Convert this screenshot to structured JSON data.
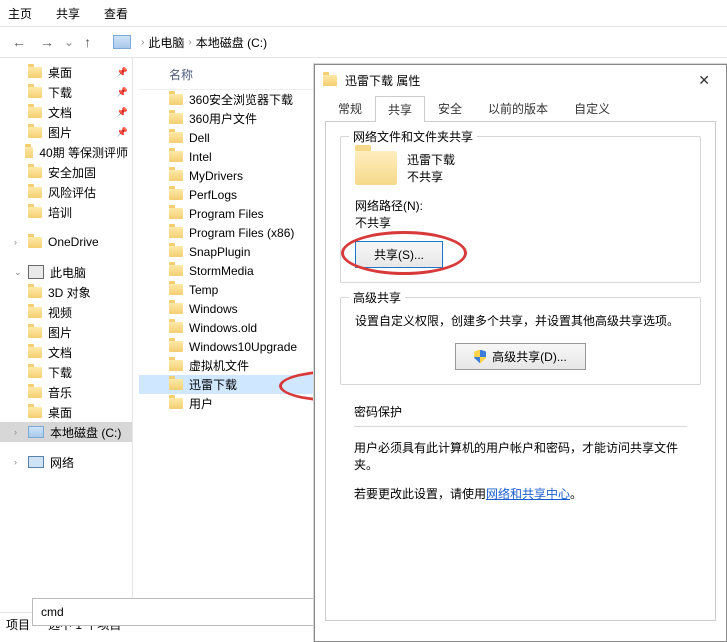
{
  "top_tabs": {
    "home": "主页",
    "share": "共享",
    "view": "查看"
  },
  "nav": {
    "back": "←",
    "fwd": "→",
    "up": "↑"
  },
  "breadcrumb": {
    "pc": "此电脑",
    "drive": "本地磁盘 (C:)"
  },
  "sidebar": {
    "quick": [
      {
        "label": "桌面"
      },
      {
        "label": "下载"
      },
      {
        "label": "文档"
      },
      {
        "label": "图片"
      },
      {
        "label": "40期 等保测评师"
      },
      {
        "label": "安全加固"
      },
      {
        "label": "风险评估"
      },
      {
        "label": "培训"
      }
    ],
    "onedrive": "OneDrive",
    "thispc": "此电脑",
    "thispc_items": [
      {
        "label": "3D 对象"
      },
      {
        "label": "视频"
      },
      {
        "label": "图片"
      },
      {
        "label": "文档"
      },
      {
        "label": "下载"
      },
      {
        "label": "音乐"
      },
      {
        "label": "桌面"
      },
      {
        "label": "本地磁盘 (C:)",
        "drive": true,
        "selected": true
      }
    ],
    "network": "网络"
  },
  "content": {
    "header": "名称",
    "files": [
      "360安全浏览器下载",
      "360用户文件",
      "Dell",
      "Intel",
      "MyDrivers",
      "PerfLogs",
      "Program Files",
      "Program Files (x86)",
      "SnapPlugin",
      "StormMedia",
      "Temp",
      "Windows",
      "Windows.old",
      "Windows10Upgrade",
      "虚拟机文件",
      "迅雷下载",
      "用户"
    ],
    "selected_index": 15
  },
  "status": {
    "items": "项目",
    "sel": "选中 1 个项目"
  },
  "search_value": "cmd",
  "dialog": {
    "title": "迅雷下载 属性",
    "tabs": {
      "general": "常规",
      "share": "共享",
      "security": "安全",
      "prev": "以前的版本",
      "custom": "自定义"
    },
    "share_group": {
      "title": "网络文件和文件夹共享",
      "name": "迅雷下载",
      "status": "不共享",
      "path_label": "网络路径(N):",
      "path_value": "不共享",
      "share_btn": "共享(S)..."
    },
    "adv_group": {
      "title": "高级共享",
      "desc": "设置自定义权限，创建多个共享，并设置其他高级共享选项。",
      "btn": "高级共享(D)..."
    },
    "pwd_group": {
      "title": "密码保护",
      "line1": "用户必须具有此计算机的用户帐户和密码，才能访问共享文件夹。",
      "line2_a": "若要更改此设置，请使用",
      "line2_link": "网络和共享中心",
      "line2_b": "。"
    }
  }
}
